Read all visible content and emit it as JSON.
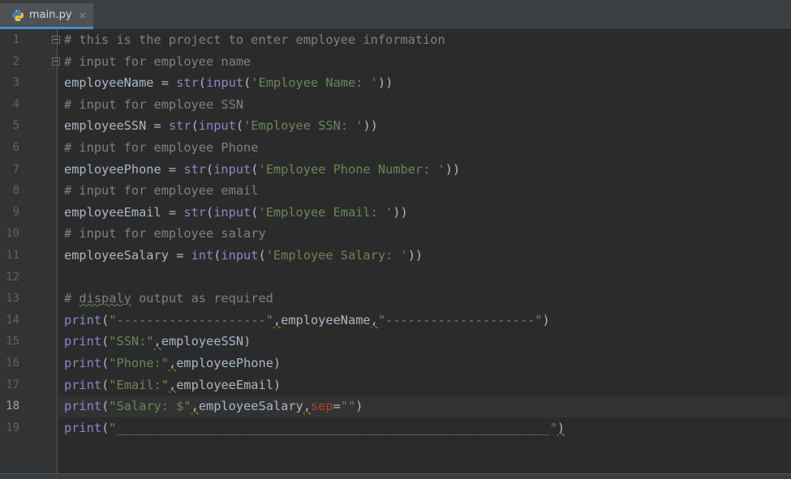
{
  "tab": {
    "filename": "main.py",
    "icon": "python-file-icon",
    "close_glyph": "×"
  },
  "active_line": 18,
  "lines": [
    {
      "n": "1"
    },
    {
      "n": "2"
    },
    {
      "n": "3"
    },
    {
      "n": "4"
    },
    {
      "n": "5"
    },
    {
      "n": "6"
    },
    {
      "n": "7"
    },
    {
      "n": "8"
    },
    {
      "n": "9"
    },
    {
      "n": "10"
    },
    {
      "n": "11"
    },
    {
      "n": "12"
    },
    {
      "n": "13"
    },
    {
      "n": "14"
    },
    {
      "n": "15"
    },
    {
      "n": "16"
    },
    {
      "n": "17"
    },
    {
      "n": "18"
    },
    {
      "n": "19"
    }
  ],
  "code": {
    "l1": "# this is the project to enter employee information",
    "l2": "# input for employee name",
    "l3a": "employeeName = ",
    "l3b": "str",
    "l3c": "(",
    "l3d": "input",
    "l3e": "(",
    "l3f": "'Employee Name: '",
    "l3g": "))",
    "l4": "# input for employee SSN",
    "l5a": "employeeSSN = ",
    "l5b": "str",
    "l5c": "(",
    "l5d": "input",
    "l5e": "(",
    "l5f": "'Employee SSN: '",
    "l5g": "))",
    "l6": "# input for employee Phone",
    "l7a": "employeePhone = ",
    "l7b": "str",
    "l7c": "(",
    "l7d": "input",
    "l7e": "(",
    "l7f": "'Employee Phone Number: '",
    "l7g": "))",
    "l8": "# input for employee email",
    "l9a": "employeeEmail = ",
    "l9b": "str",
    "l9c": "(",
    "l9d": "input",
    "l9e": "(",
    "l9f": "'Employee Email: '",
    "l9g": "))",
    "l10": "# input for employee salary",
    "l11a": "employeeSalary = ",
    "l11b": "int",
    "l11c": "(",
    "l11d": "input",
    "l11e": "(",
    "l11f": "'Employee Salary: '",
    "l11g": "))",
    "l13a": "# ",
    "l13b": "dispaly",
    "l13c": " output as required",
    "l14a": "print",
    "l14b": "(",
    "l14c": "\"--------------------\"",
    "l14d": ",",
    "l14e": "employeeName",
    "l14f": ",",
    "l14g": "\"--------------------\"",
    "l14h": ")",
    "l15a": "print",
    "l15b": "(",
    "l15c": "\"SSN:\"",
    "l15d": ",",
    "l15e": "employeeSSN)",
    "l16a": "print",
    "l16b": "(",
    "l16c": "\"Phone:\"",
    "l16d": ",",
    "l16e": "employeePhone)",
    "l17a": "print",
    "l17b": "(",
    "l17c": "\"Email:\"",
    "l17d": ",",
    "l17e": "employeeEmail)",
    "l18a": "print",
    "l18b": "(",
    "l18c": "\"Salary: $\"",
    "l18d": ",",
    "l18e": "employeeSalary",
    "l18f": ",",
    "l18g": "sep",
    "l18h": "=",
    "l18i": "\"\"",
    "l18j": ")",
    "l19a": "print",
    "l19b": "(",
    "l19c": "\"__________________________________________________________\"",
    "l19d": ")"
  },
  "colors": {
    "background": "#2b2b2b",
    "gutter": "#313335",
    "comment": "#808080",
    "string": "#6a8759",
    "builtin": "#8888c6",
    "keyword_arg": "#aa4926",
    "text": "#a9b7c6"
  }
}
